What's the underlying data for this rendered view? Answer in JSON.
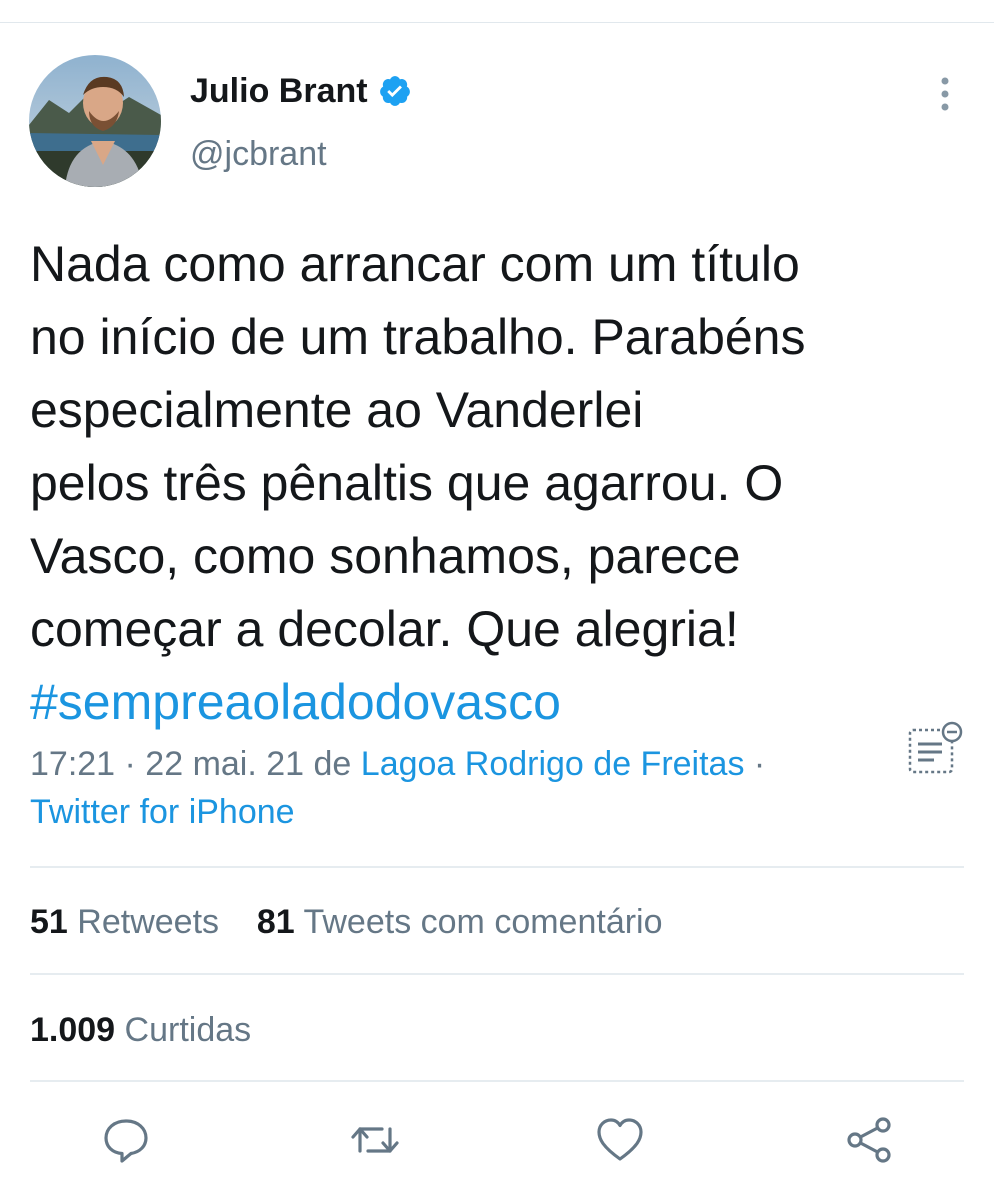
{
  "author": {
    "name": "Julio Brant",
    "handle": "@jcbrant",
    "verified": true,
    "avatar_icon": "profile-photo"
  },
  "tweet": {
    "lines": [
      "Nada como arrancar com um título",
      "no início de um trabalho. Parabéns",
      "especialmente ao Vanderlei",
      "pelos três pênaltis que agarrou. O",
      "Vasco, como sonhamos, parece",
      "começar a decolar. Que alegria!"
    ],
    "hashtag": "#sempreaoladodovasco"
  },
  "meta": {
    "time_date": "17:21 · 22 mai. 21 de ",
    "location": "Lagoa Rodrigo de Freitas",
    "separator": " ·",
    "source": "Twitter for iPhone"
  },
  "stats": {
    "retweets_count": "51",
    "retweets_label": "Retweets",
    "quote_count": "81",
    "quote_label": "Tweets com comentário",
    "likes_count": "1.009",
    "likes_label": "Curtidas"
  },
  "actions": [
    "reply-icon",
    "retweet-icon",
    "like-icon",
    "share-icon"
  ],
  "colors": {
    "text": "#14171a",
    "muted": "#657786",
    "link": "#1b95e0",
    "divider": "#e6ecf0"
  }
}
